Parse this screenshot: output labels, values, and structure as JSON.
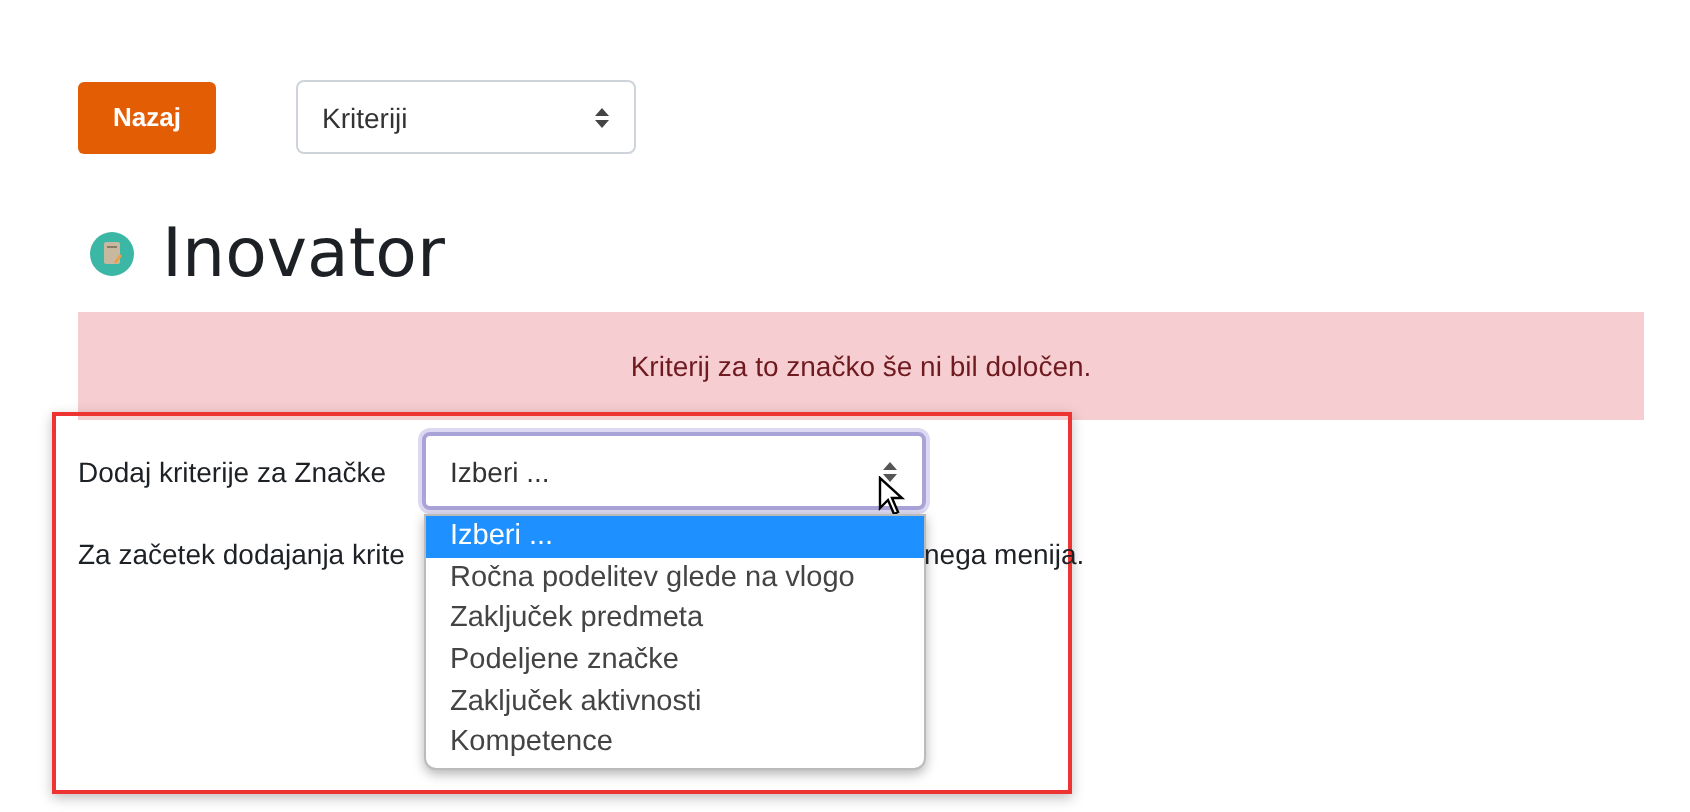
{
  "back_button": "Nazaj",
  "view_select": {
    "value": "Kriteriji"
  },
  "badge": {
    "title": "Inovator"
  },
  "alert": "Kriterij za to značko še ni bil določen.",
  "add_criteria": {
    "label": "Dodaj kriterije za Značke",
    "value": "Izberi ...",
    "options": [
      {
        "label": "Izberi ...",
        "selected": true
      },
      {
        "label": "Ročna podelitev glede na vlogo",
        "selected": false
      },
      {
        "label": "Zaključek predmeta",
        "selected": false
      },
      {
        "label": "Podeljene značke",
        "selected": false
      },
      {
        "label": "Zaključek aktivnosti",
        "selected": false
      },
      {
        "label": "Kompetence",
        "selected": false
      }
    ]
  },
  "hint_parts": [
    "Za začetek dodajanja krite",
    "nega menija."
  ]
}
